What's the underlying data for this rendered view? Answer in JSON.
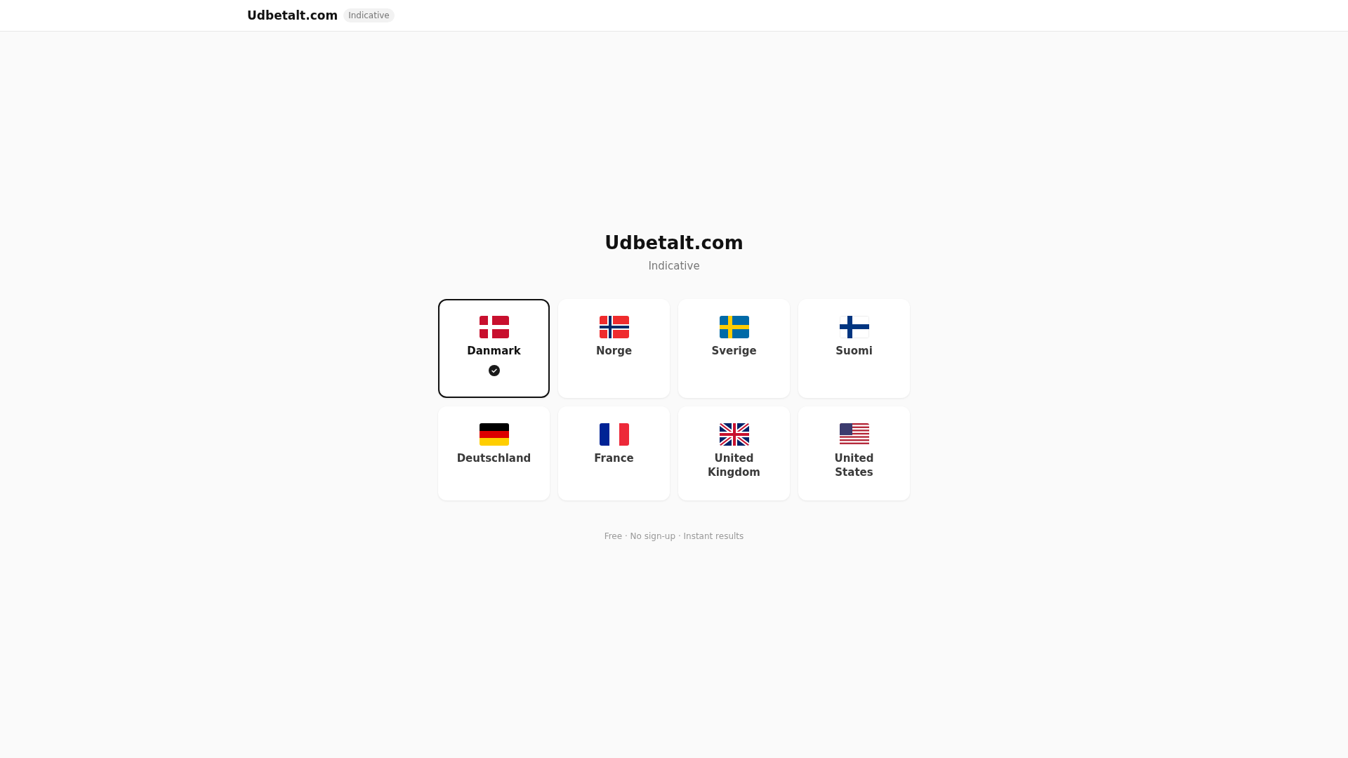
{
  "header": {
    "brand": "Udbetalt.com",
    "badge": "Indicative"
  },
  "hero": {
    "title": "Udbetalt.com",
    "subtitle": "Indicative"
  },
  "countries": [
    {
      "name": "Danmark",
      "selected": true
    },
    {
      "name": "Norge",
      "selected": false
    },
    {
      "name": "Sverige",
      "selected": false
    },
    {
      "name": "Suomi",
      "selected": false
    },
    {
      "name": "Deutschland",
      "selected": false
    },
    {
      "name": "France",
      "selected": false
    },
    {
      "name": "United Kingdom",
      "selected": false
    },
    {
      "name": "United States",
      "selected": false
    }
  ],
  "footer_note": "Free · No sign-up · Instant results"
}
